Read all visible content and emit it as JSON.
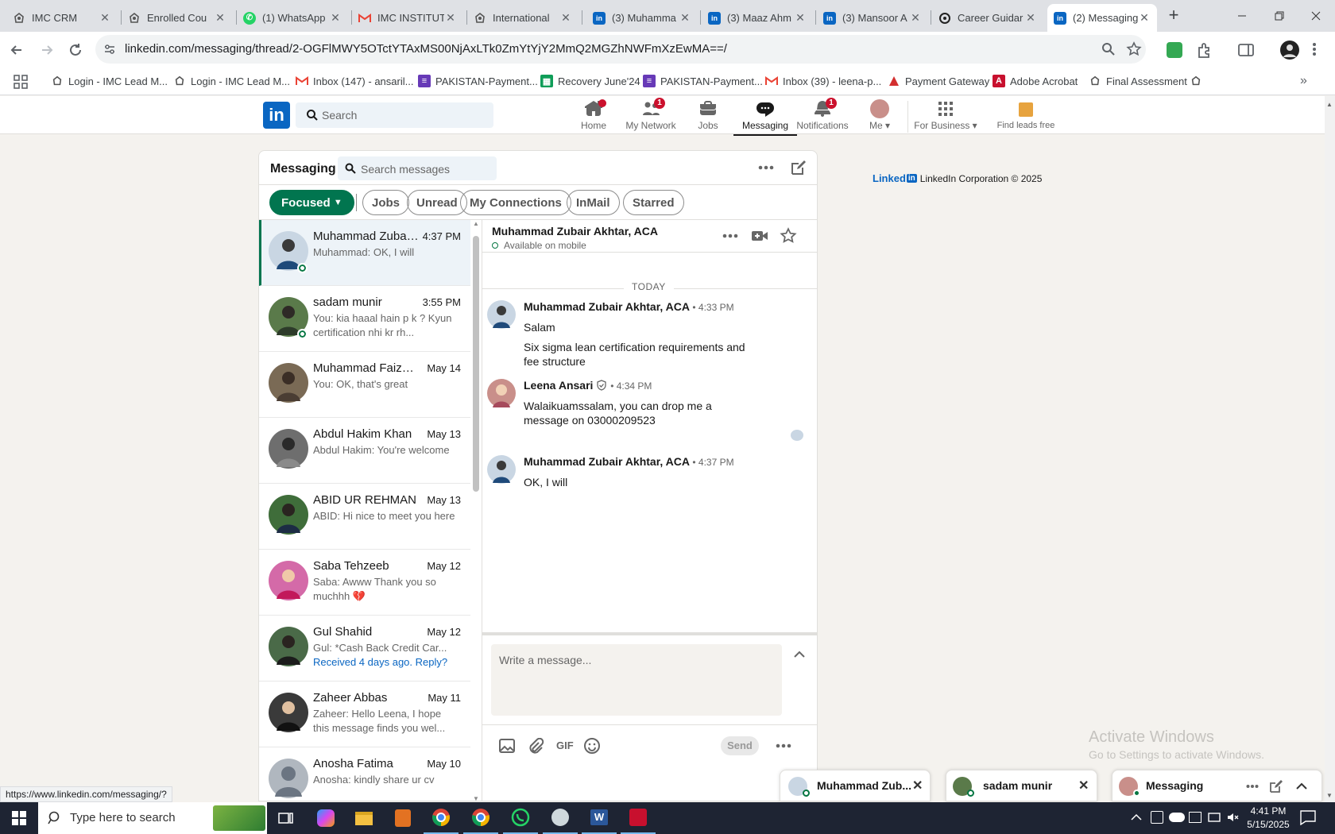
{
  "browser": {
    "tabs": [
      {
        "title": "IMC CRM",
        "icon": "imc-icon"
      },
      {
        "title": "Enrolled Cou",
        "icon": "imc-icon"
      },
      {
        "title": "(1) WhatsApp",
        "icon": "whatsapp-icon"
      },
      {
        "title": "IMC INSTITUT",
        "icon": "gmail-icon"
      },
      {
        "title": "International",
        "icon": "imc-icon"
      },
      {
        "title": "(3) Muhamma",
        "icon": "linkedin-icon"
      },
      {
        "title": "(3) Maaz Ahm",
        "icon": "linkedin-icon"
      },
      {
        "title": "(3) Mansoor A",
        "icon": "linkedin-icon"
      },
      {
        "title": "Career Guidar",
        "icon": "openai-icon"
      },
      {
        "title": "(2) Messaging",
        "icon": "linkedin-icon"
      }
    ],
    "url": "linkedin.com/messaging/thread/2-OGFlMWY5OTctYTAxMS00NjAxLTk0ZmYtYjY2MmQ2MGZhNWFmXzEwMA==/",
    "bookmarks": [
      {
        "label": "Login - IMC Lead M...",
        "icon": "imc-icon"
      },
      {
        "label": "Login - IMC Lead M...",
        "icon": "imc-icon"
      },
      {
        "label": "Inbox (147) - ansaril...",
        "icon": "gmail-icon"
      },
      {
        "label": "PAKISTAN-Payment...",
        "icon": "purple-doc-icon"
      },
      {
        "label": "Recovery June'24",
        "icon": "sheets-icon"
      },
      {
        "label": "PAKISTAN-Payment...",
        "icon": "purple-doc-icon"
      },
      {
        "label": "Inbox (39) - leena-p...",
        "icon": "gmail-icon"
      },
      {
        "label": "Payment Gateway",
        "icon": "red-triangle-icon"
      },
      {
        "label": "Adobe Acrobat",
        "icon": "acrobat-icon"
      },
      {
        "label": "Final Assessment",
        "icon": "imc-icon"
      }
    ],
    "status_url": "https://www.linkedin.com/messaging/?"
  },
  "linkedin_nav": {
    "search_placeholder": "Search",
    "items": [
      {
        "label": "Home",
        "badge": ""
      },
      {
        "label": "My Network",
        "badge": "1"
      },
      {
        "label": "Jobs",
        "badge": ""
      },
      {
        "label": "Messaging",
        "badge": ""
      },
      {
        "label": "Notifications",
        "badge": "1"
      },
      {
        "label": "Me",
        "badge": ""
      },
      {
        "label": "For Business",
        "badge": ""
      },
      {
        "label": "Find leads free",
        "badge": ""
      }
    ]
  },
  "messaging": {
    "title": "Messaging",
    "search_placeholder": "Search messages",
    "filters": [
      "Focused",
      "Jobs",
      "Unread",
      "My Connections",
      "InMail",
      "Starred"
    ],
    "conversations": [
      {
        "name": "Muhammad Zubair...",
        "time": "4:37 PM",
        "preview": "Muhammad: OK, I will",
        "online": true,
        "color": "#c9d6e3"
      },
      {
        "name": "sadam munir",
        "time": "3:55 PM",
        "preview": "You: kia haaal hain p k ? Kyun certification nhi kr rh...",
        "online": true,
        "color": "#5a7a4a"
      },
      {
        "name": "Muhammad Faizan ...",
        "time": "May 14",
        "preview": "You: OK, that's great",
        "online": false,
        "color": "#7a6a55"
      },
      {
        "name": "Abdul Hakim Khan",
        "time": "May 13",
        "preview": "Abdul Hakim: You're welcome",
        "online": false,
        "color": "#6e6e6e"
      },
      {
        "name": "ABID UR REHMAN",
        "time": "May 13",
        "preview": "ABID: Hi nice to meet you here",
        "online": false,
        "color": "#3f6d3a"
      },
      {
        "name": "Saba Tehzeeb",
        "time": "May 12",
        "preview": "Saba: Awww Thank you so muchhh 💔",
        "online": false,
        "color": "#d46aa8"
      },
      {
        "name": "Gul Shahid",
        "time": "May 12",
        "preview": "Gul: *Cash Back Credit Car...",
        "extra": "Received 4 days ago. Reply?",
        "online": false,
        "color": "#4a6a48"
      },
      {
        "name": "Zaheer Abbas",
        "time": "May 11",
        "preview": "Zaheer: Hello Leena, I hope this message finds you wel...",
        "online": false,
        "color": "#3a3a3a"
      },
      {
        "name": "Anosha Fatima",
        "time": "May 10",
        "preview": "Anosha: kindly share ur cv",
        "online": false,
        "color": "#b0b7bf"
      }
    ],
    "thread": {
      "name": "Muhammad Zubair Akhtar, ACA",
      "status": "Available on mobile",
      "day_label": "TODAY",
      "messages": [
        {
          "sender": "Muhammad Zubair Akhtar, ACA",
          "time": "• 4:33 PM",
          "lines": [
            "Salam",
            "Six sigma lean certification requirements and fee structure"
          ]
        },
        {
          "sender": "Leena Ansari",
          "time": "• 4:34 PM",
          "lines": [
            "Walaikuamssalam, you can drop me a message on 03000209523"
          ]
        },
        {
          "sender": "Muhammad Zubair Akhtar, ACA",
          "time": "• 4:37 PM",
          "lines": [
            "OK, I will"
          ]
        }
      ],
      "compose_placeholder": "Write a message...",
      "gif_label": "GIF",
      "send_label": "Send"
    }
  },
  "footer": {
    "brand": "Linked",
    "brand_in": "in",
    "text": "LinkedIn Corporation © 2025"
  },
  "watermark": {
    "line1": "Activate Windows",
    "line2": "Go to Settings to activate Windows."
  },
  "chat_bubbles": [
    {
      "name": "Muhammad Zub..."
    },
    {
      "name": "sadam munir"
    },
    {
      "name": "Messaging"
    }
  ],
  "taskbar": {
    "search_placeholder": "Type here to search",
    "time": "4:41 PM",
    "date": "5/15/2025"
  },
  "colors": {
    "linkedin_blue": "#0a66c2",
    "linkedin_green": "#01754f",
    "badge_red": "#cb112d"
  }
}
